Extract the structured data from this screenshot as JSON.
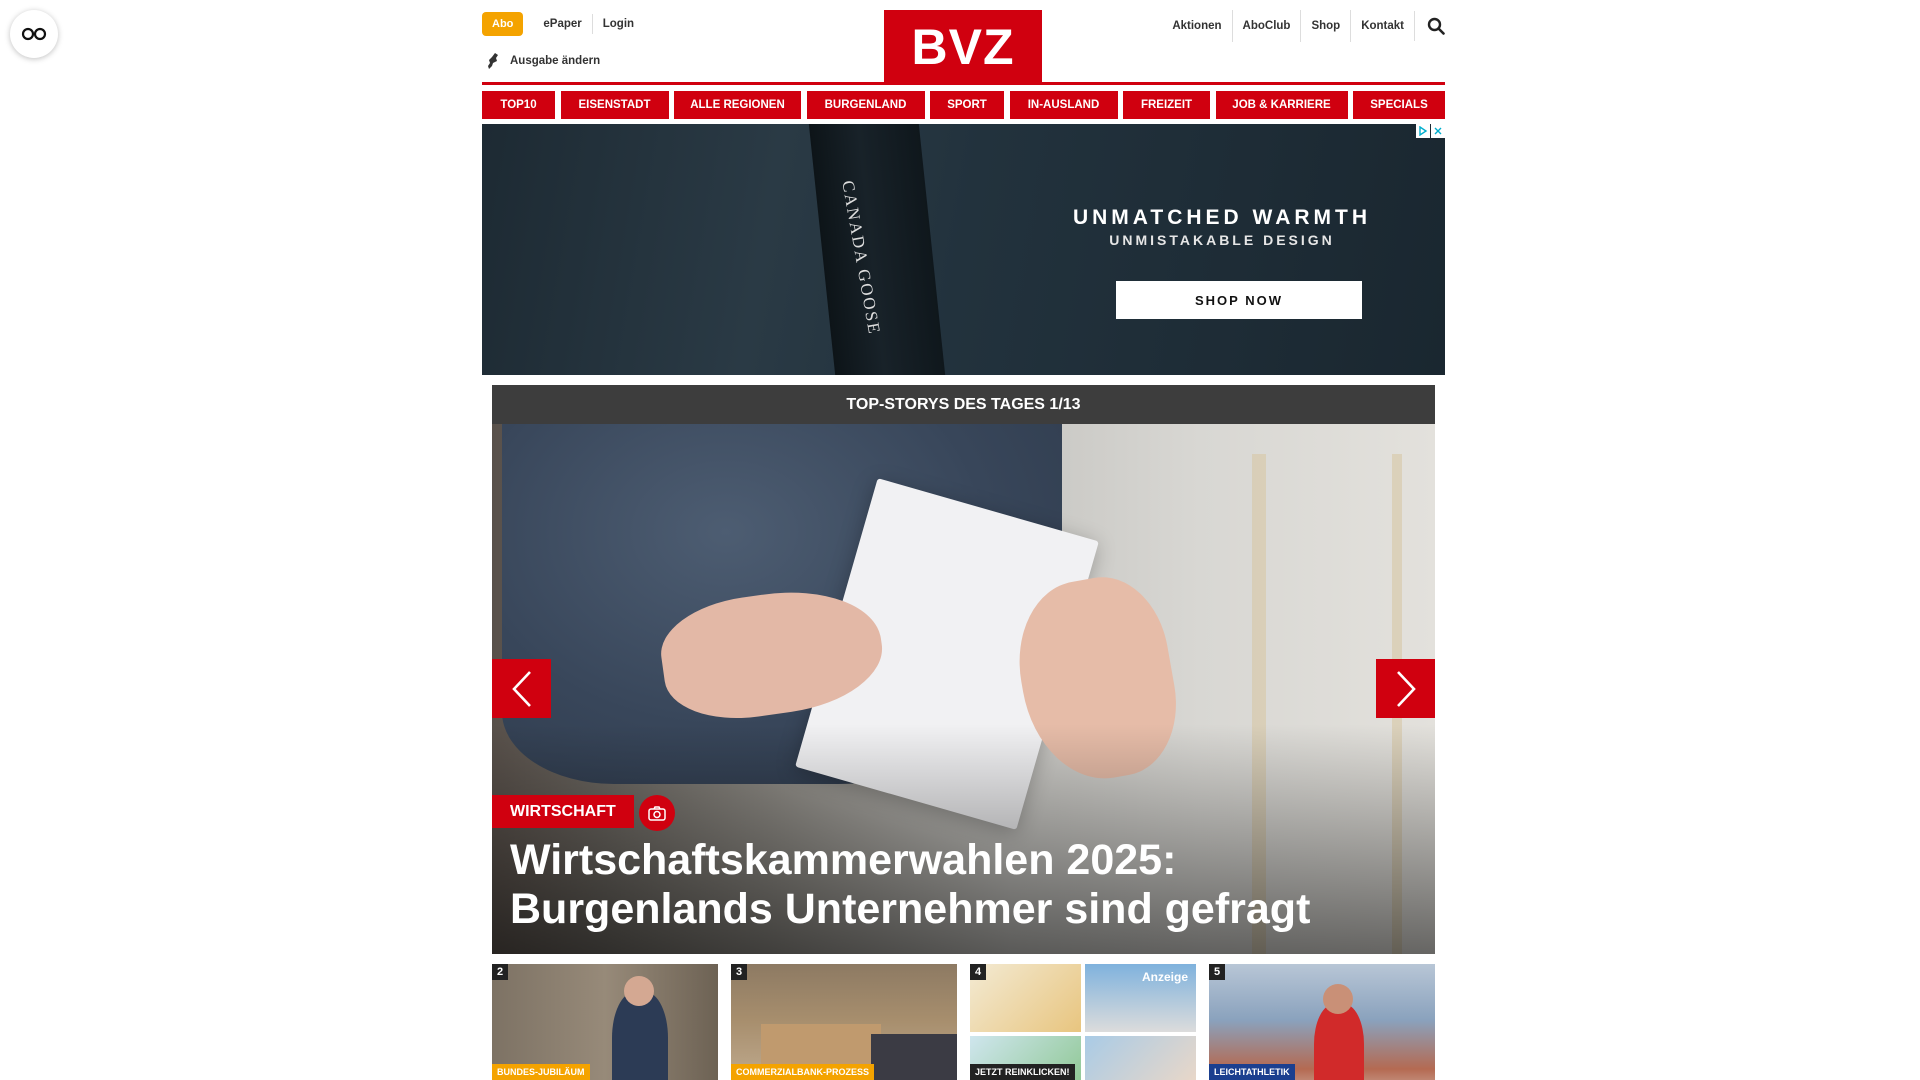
{
  "accessibility": {
    "icon": "glasses-icon"
  },
  "header": {
    "abo_label": "Abo",
    "left_links": [
      "ePaper",
      "Login"
    ],
    "edition_label": "Ausgabe ändern",
    "logo_text": "BVZ",
    "right_links": [
      "Aktionen",
      "AboClub",
      "Shop",
      "Kontakt"
    ],
    "search_icon": "search-icon"
  },
  "nav": {
    "items": [
      "TOP10",
      "EISENSTADT",
      "ALLE REGIONEN",
      "BURGENLAND",
      "SPORT",
      "IN-AUSLAND",
      "FREIZEIT",
      "JOB & KARRIERE",
      "SPECIALS"
    ]
  },
  "ad": {
    "brand": "CANADA GOOSE",
    "headline": "UNMATCHED WARMTH",
    "subline": "UNMISTAKABLE DESIGN",
    "cta": "SHOP NOW"
  },
  "top_stories": {
    "heading": "TOP-STORYS DES TAGES 1/13",
    "category": "WIRTSCHAFT",
    "title_line1": "Wirtschaftskammerwahlen 2025:",
    "title_line2": "Burgenlands Unternehmer sind gefragt"
  },
  "teasers": [
    {
      "number": "2",
      "tag": "BUNDES-JUBILÄUM"
    },
    {
      "number": "3",
      "tag": "COMMERZIALBANK-PROZESS"
    },
    {
      "number": "4",
      "tag": "JETZT REINKLICKEN!",
      "label": "Anzeige"
    },
    {
      "number": "5",
      "tag": "LEICHTATHLETIK"
    }
  ],
  "colors": {
    "brand_red": "#d0000f",
    "abo_orange": "#f4a300",
    "header_dark": "#3d3d3d"
  }
}
